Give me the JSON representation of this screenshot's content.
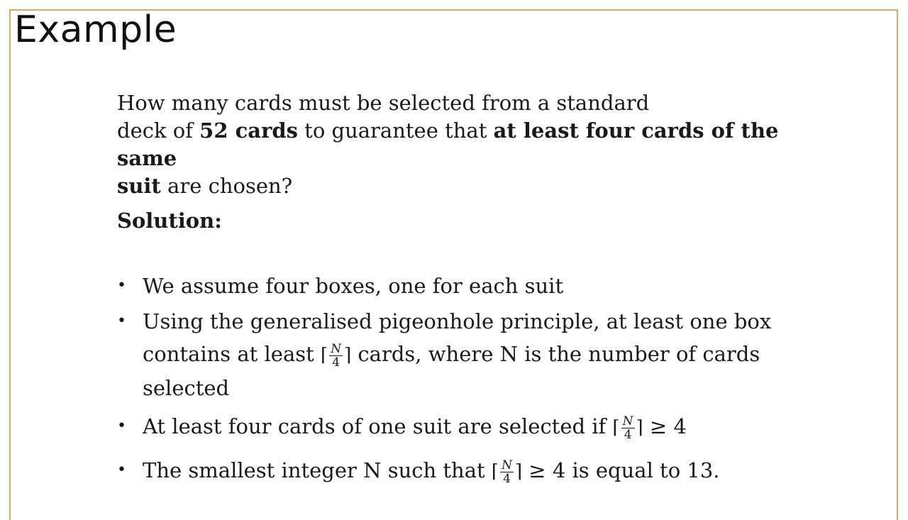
{
  "slide": {
    "title": "Example",
    "question": {
      "part1": "How many cards must be selected from a standard",
      "part2": "deck of ",
      "bold1": "52 cards",
      "part3": " to guarantee that ",
      "bold2": "at least four cards of the same",
      "bold3": "suit",
      "part4": " are chosen?"
    },
    "solution_label": "Solution:",
    "bullets": [
      {
        "text": "We assume four boxes, one for each suit"
      },
      {
        "text_a": "Using the generalised pigeonhole principle, at least one box",
        "text_b": "contains at least ",
        "text_c": " cards, where N is the number of cards",
        "text_d": "selected"
      },
      {
        "text_a": "At least four cards of one suit are selected if ",
        "text_b": " ≥ 4"
      },
      {
        "text_a": "The smallest integer N such that ",
        "text_b": " ≥ 4 is equal to 13."
      }
    ],
    "fraction": {
      "numerator": "N",
      "denominator": "4",
      "ceil_left": "⌈",
      "ceil_right": "⌉"
    },
    "bullet_glyph": "•",
    "colors": {
      "frame": "#e0a867",
      "text": "#1a1a1a"
    }
  }
}
